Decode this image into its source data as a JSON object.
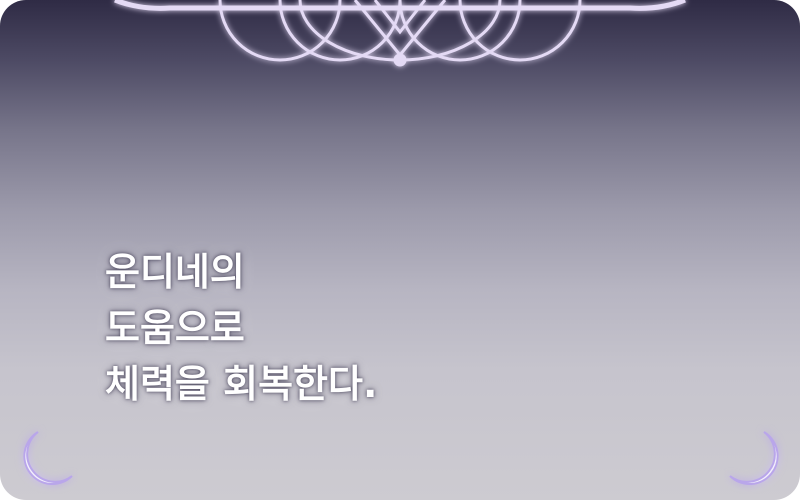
{
  "scene": {
    "colors": {
      "bg_top": "#2f2b45",
      "bg_bottom": "#cdcbd1",
      "ornament": "#e4daf5",
      "ornament_glow": "#b9a6ea",
      "text": "#ffffff"
    },
    "decorations": {
      "top": "crest-ornament-icon",
      "bottom_left": "crescent-moon-icon",
      "bottom_right": "crescent-moon-icon"
    }
  },
  "caption": {
    "lines": [
      "운디네의",
      "도움으로",
      "체력을 회복한다."
    ]
  }
}
